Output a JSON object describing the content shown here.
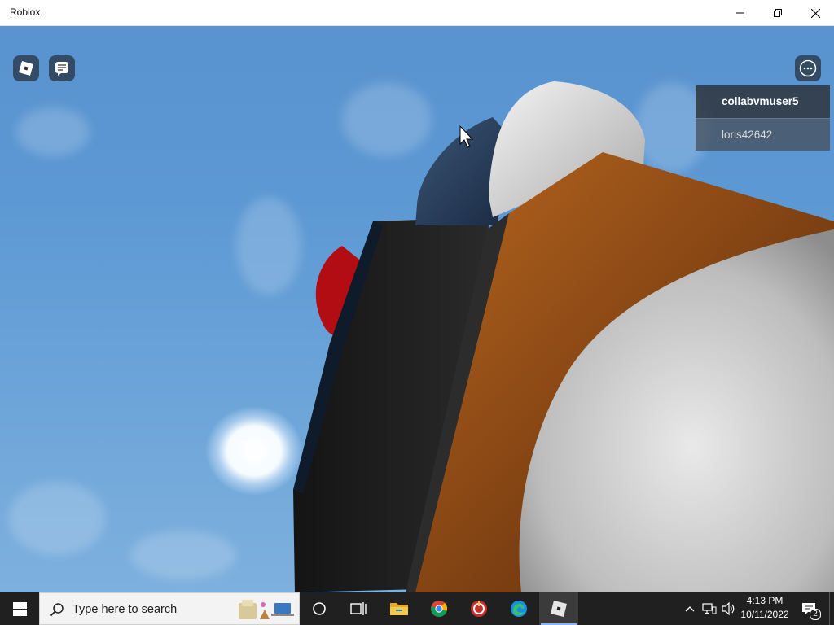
{
  "window": {
    "title": "Roblox",
    "controls": [
      "minimize-icon",
      "restore-icon",
      "close-icon"
    ]
  },
  "game": {
    "top_left_buttons": [
      "roblox-menu-icon",
      "chat-icon"
    ],
    "top_right_button": "more-icon",
    "player_list": [
      {
        "name": "collabvmuser5",
        "local": true
      },
      {
        "name": "loris42642",
        "local": false
      }
    ]
  },
  "taskbar": {
    "search_placeholder": "Type here to search",
    "pinned": [
      "cortana-icon",
      "task-view-icon",
      "file-explorer-icon",
      "chrome-icon",
      "red-app-icon",
      "edge-icon",
      "roblox-icon"
    ],
    "tray": {
      "time": "4:13 PM",
      "date": "10/11/2022",
      "notification_count": "2"
    }
  }
}
